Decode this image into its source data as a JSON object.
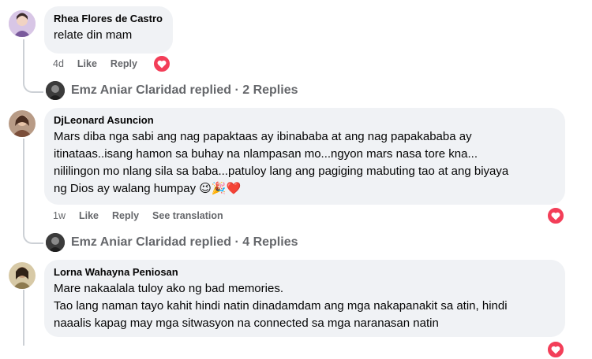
{
  "comments": [
    {
      "author": "Rhea Flores de Castro",
      "text": "relate din mam",
      "time": "4d",
      "like_label": "Like",
      "reply_label": "Reply",
      "reaction": "heart-icon"
    },
    {
      "author": "DjLeonard Asuncion",
      "lines": [
        "Mars diba nga sabi ang nag papaktaas ay ibinababa at ang nag papakababa ay",
        "itinataas..isang hamon sa buhay na nlampasan mo...ngyon mars nasa tore kna...",
        "nililingon mo nlang sila sa baba...patuloy lang ang pagiging mabuting tao at ang biyaya",
        "ng Dios ay walang humpay"
      ],
      "emojis": [
        "😉",
        "🎉",
        "❤️"
      ],
      "time": "1w",
      "like_label": "Like",
      "reply_label": "Reply",
      "translate_label": "See translation",
      "reaction": "heart-icon"
    },
    {
      "author": "Lorna Wahayna Peniosan",
      "lines": [
        "Mare nakaalala tuloy ako ng bad memories.",
        "Tao lang naman tayo kahit hindi natin dinadamdam ang mga nakapanakit sa atin, hindi",
        "naaalis kapag may mga sitwasyon na connected sa mga naranasan natin"
      ],
      "reaction": "heart-icon"
    }
  ],
  "replies": [
    {
      "text": "Emz Aniar Claridad replied · 2 Replies"
    },
    {
      "text": "Emz Aniar Claridad replied · 4 Replies"
    }
  ],
  "colors": {
    "bubble": "#f0f2f5",
    "meta": "#65676b",
    "heart": "#f33e58",
    "thread_line": "#ccd0d5"
  }
}
